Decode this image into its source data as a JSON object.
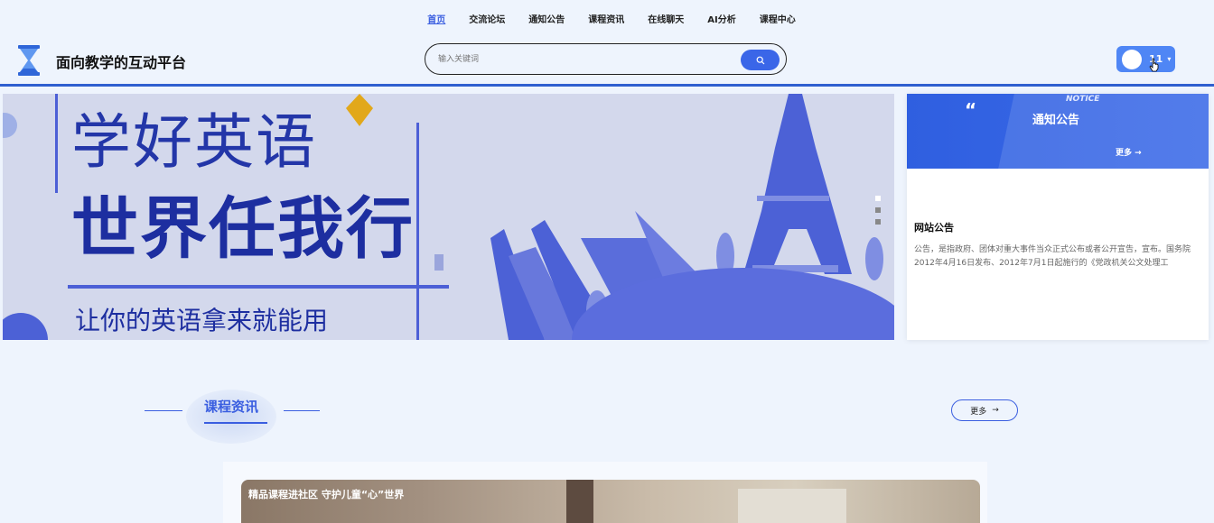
{
  "nav": {
    "items": [
      {
        "label": "首页",
        "active": true
      },
      {
        "label": "交流论坛",
        "active": false
      },
      {
        "label": "通知公告",
        "active": false
      },
      {
        "label": "课程资讯",
        "active": false
      },
      {
        "label": "在线聊天",
        "active": false
      },
      {
        "label": "AI分析",
        "active": false
      },
      {
        "label": "课程中心",
        "active": false
      }
    ]
  },
  "header": {
    "site_title": "面向教学的互动平台",
    "search_placeholder": "输入关键词",
    "user_name": "11",
    "accent_color": "#3a5ee0"
  },
  "banner": {
    "line1": "学好英语",
    "line2": "世界任我行",
    "line3": "让你的英语拿来就能用",
    "slides": 3,
    "active_slide": 1
  },
  "notice": {
    "label_en": "NOTICE",
    "title": "通知公告",
    "more": "更多 →",
    "item_title": "网站公告",
    "item_text": "公告，是指政府、团体对重大事件当众正式公布或者公开宣告，宣布。国务院2012年4月16日发布、2012年7月1日起施行的《党政机关公文处理工"
  },
  "section": {
    "title": "课程资讯",
    "more": "更多"
  },
  "course": {
    "title": "精品课程进社区 守护儿童“心”世界"
  }
}
